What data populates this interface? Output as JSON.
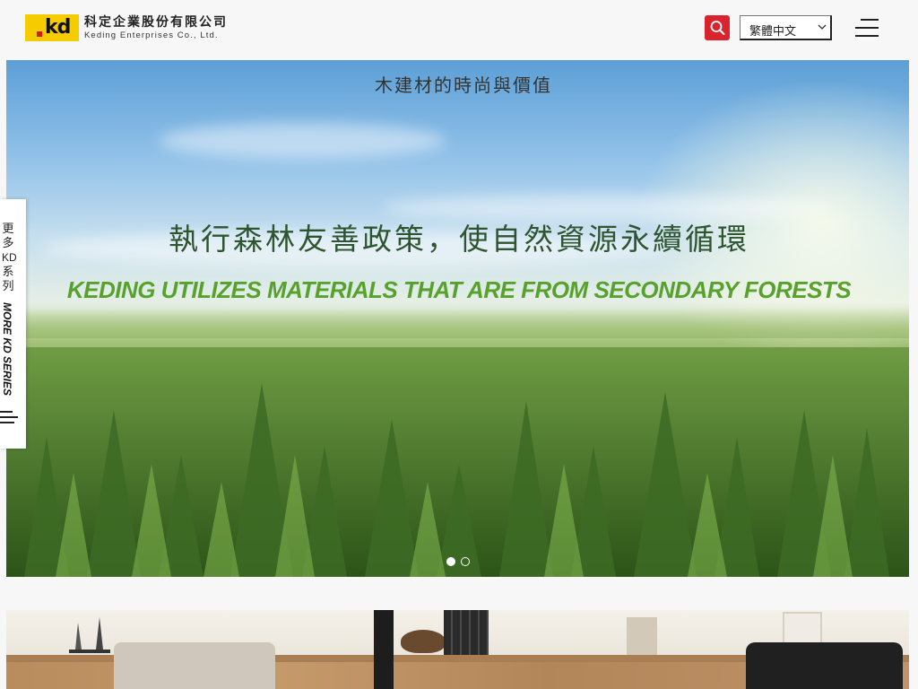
{
  "header": {
    "logo_mark": "kd",
    "company_name_zh": "科定企業股份有限公司",
    "company_name_en": "Keding Enterprises Co., Ltd.",
    "search_icon": "search-icon",
    "language_selected": "繁體中文",
    "menu_icon": "hamburger-menu-icon"
  },
  "hero": {
    "title": "執行森林友善政策，使自然資源永續循環",
    "subtitle": "KEDING UTILIZES MATERIALS THAT ARE FROM SECONDARY FORESTS",
    "slides_total": 2,
    "active_slide": 1
  },
  "side_tab": {
    "label_zh_chars": [
      "更",
      "多",
      "KD",
      "系",
      "列"
    ],
    "label_en": "MORE KD SERIES"
  },
  "section2": {
    "title": "木建材的時尚與價值"
  },
  "colors": {
    "brand_yellow": "#f5cc00",
    "brand_red": "#d61a1a",
    "search_red": "#d9232d",
    "subtitle_green": "#57a12c"
  }
}
